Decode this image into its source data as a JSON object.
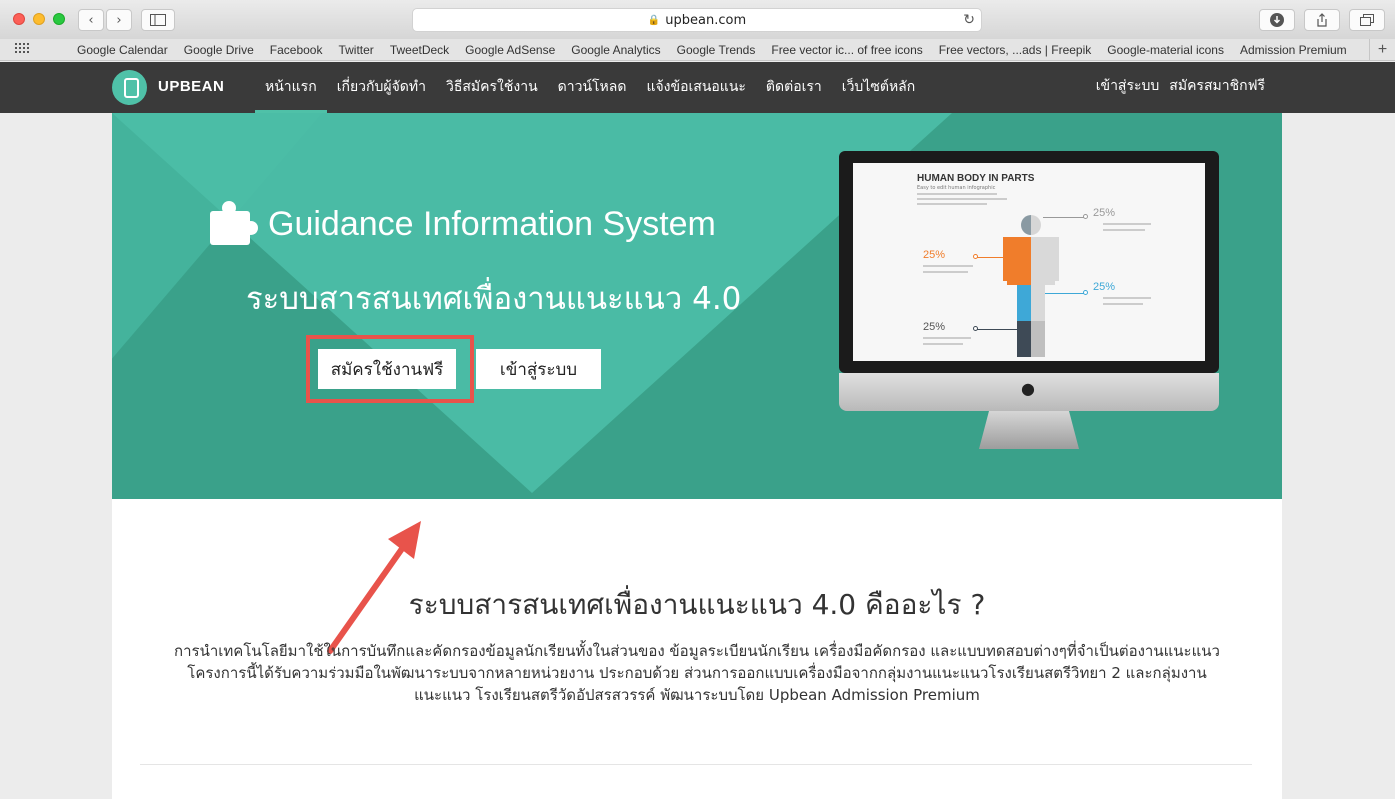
{
  "browser": {
    "url": "upbean.com",
    "bookmarks": [
      "Google Calendar",
      "Google Drive",
      "Facebook",
      "Twitter",
      "TweetDeck",
      "Google AdSense",
      "Google Analytics",
      "Google Trends",
      "Free vector ic... of free icons",
      "Free vectors, ...ads | Freepik",
      "Google-material icons",
      "Admission Premium"
    ]
  },
  "nav": {
    "brand": "UPBEAN",
    "items": [
      "หน้าแรก",
      "เกี่ยวกับผู้จัดทำ",
      "วิธีสมัครใช้งาน",
      "ดาวน์โหลด",
      "แจ้งข้อเสนอแนะ",
      "ติดต่อเรา",
      "เว็บไซต์หลัก"
    ],
    "login": "เข้าสู่ระบบ",
    "signup": "สมัครสมาชิกฟรี"
  },
  "hero": {
    "title": "Guidance Information System",
    "subtitle": "ระบบสารสนเทศเพื่องานแนะแนว 4.0",
    "signup_button": "สมัครใช้งานฟรี",
    "login_button": "เข้าสู่ระบบ",
    "highlight_color": "#e8534b",
    "infographic": {
      "title": "HUMAN BODY IN PARTS",
      "subtitle": "Easy to edit human infographic",
      "labels": [
        "25%",
        "25%",
        "25%",
        "25%"
      ]
    }
  },
  "content": {
    "title": "ระบบสารสนเทศเพื่องานแนะแนว 4.0 คืออะไร ?",
    "body": "การนำเทคโนโลยีมาใช้ในการบันทึกและคัดกรองข้อมูลนักเรียนทั้งในส่วนของ ข้อมูลระเบียนนักเรียน เครื่องมือคัดกรอง และแบบทดสอบต่างๆที่จำเป็นต่องานแนะแนว โครงการนี้ได้รับความร่วมมือในพัฒนาระบบจากหลายหน่วยงาน ประกอบด้วย ส่วนการออกแบบเครื่องมือจากกลุ่มงานแนะแนวโรงเรียนสตรีวิทยา 2 และกลุ่มงานแนะแนว โรงเรียนสตรีวัดอัปสรสวรรค์ พัฒนาระบบโดย Upbean Admission Premium"
  },
  "colors": {
    "hero_bg": "#3aa18a",
    "accent": "#4fc1a8",
    "nav_bg": "#3a3a3a"
  }
}
